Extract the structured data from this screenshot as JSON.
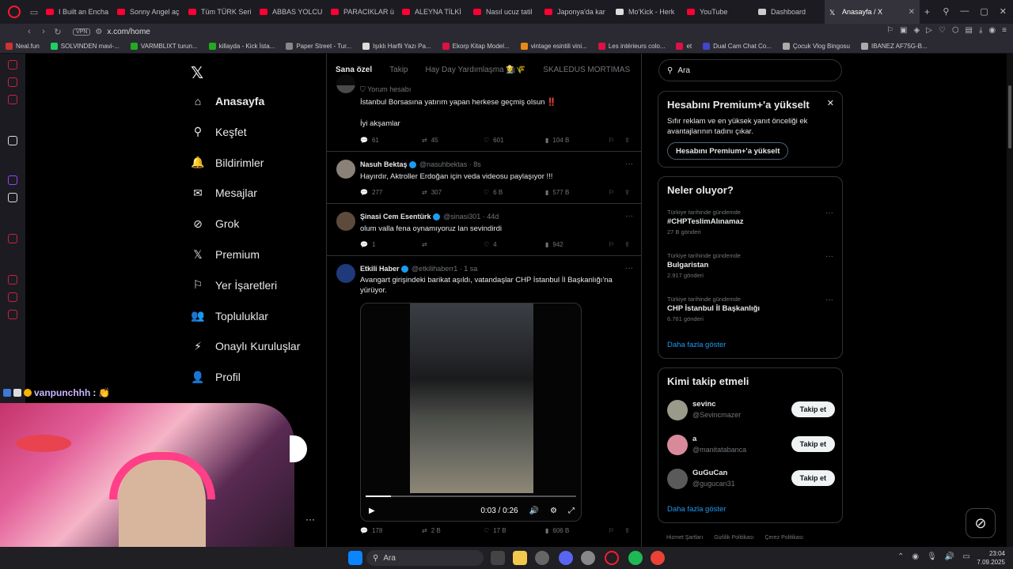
{
  "browser": {
    "tabs": [
      {
        "label": "I Built an Encha",
        "icon": "youtube-icon"
      },
      {
        "label": "Sonny Angel aç",
        "icon": "youtube-icon"
      },
      {
        "label": "Tüm TÜRK Seri",
        "icon": "youtube-icon"
      },
      {
        "label": "ABBAS YOLCU",
        "icon": "youtube-icon"
      },
      {
        "label": "PARACIKLAR ü",
        "icon": "youtube-icon"
      },
      {
        "label": "ALEYNA TİLKİ",
        "icon": "youtube-icon"
      },
      {
        "label": "Nasıl ucuz tatil",
        "icon": "youtube-icon"
      },
      {
        "label": "Japonya'da kar",
        "icon": "youtube-icon"
      },
      {
        "label": "Mo'Kick - Herk",
        "icon": "page-icon"
      },
      {
        "label": "YouTube",
        "icon": "youtube-icon"
      },
      {
        "label": "Dashboard",
        "icon": "dashboard-icon"
      },
      {
        "label": "Anasayfa / X",
        "icon": "x-icon",
        "active": true
      }
    ],
    "url": "x.com/home",
    "vpn_label": "VPN",
    "bookmarks": [
      "Neal.fun",
      "SOLVINDEN mavi-...",
      "VARMBLIXT turun...",
      "killayda - Kick İsta...",
      "Paper Street - Tur...",
      "Işıklı Harfli Yazı Pa...",
      "Ekorp Kitap Model...",
      "vintage esintili vini...",
      "Les intérieurs colo...",
      "et",
      "Dual Cam Chat Co...",
      "Çocuk Vlog Bingosu",
      "IBANEZ AF75G-B..."
    ]
  },
  "nav": {
    "logo": "𝕏",
    "items": [
      {
        "label": "Anasayfa",
        "icon": "home-icon",
        "glyph": "⌂",
        "active": true
      },
      {
        "label": "Keşfet",
        "icon": "search-icon",
        "glyph": "⚲"
      },
      {
        "label": "Bildirimler",
        "icon": "bell-icon",
        "glyph": "🔔"
      },
      {
        "label": "Mesajlar",
        "icon": "mail-icon",
        "glyph": "✉"
      },
      {
        "label": "Grok",
        "icon": "grok-icon",
        "glyph": "⊘"
      },
      {
        "label": "Premium",
        "icon": "x-icon",
        "glyph": "𝕏"
      },
      {
        "label": "Yer İşaretleri",
        "icon": "bookmark-icon",
        "glyph": "⚐"
      },
      {
        "label": "Topluluklar",
        "icon": "communities-icon",
        "glyph": "👥"
      },
      {
        "label": "Onaylı Kuruluşlar",
        "icon": "lightning-icon",
        "glyph": "⚡"
      },
      {
        "label": "Profil",
        "icon": "person-icon",
        "glyph": "👤"
      }
    ]
  },
  "feed": {
    "tabs": [
      "Sana özel",
      "Takip",
      "Hay Day Yardımlaşma 👩‍🌾🌾",
      "SKALEDUS MORTIMAS"
    ],
    "tweets": [
      {
        "context": "Yorum hesabı",
        "body": "İstanbul Borsasına yatırım yapan herkese geçmiş olsun ‼️",
        "body2": "İyi akşamlar",
        "replies": "61",
        "reposts": "45",
        "likes": "601",
        "views": "104 B"
      },
      {
        "name": "Nasuh Bektaş",
        "handle": "@nasuhbektas · 8s",
        "body": "Hayırdır,  Aktroller Erdoğan için veda videosu paylaşıyor !!!",
        "replies": "277",
        "reposts": "307",
        "likes": "6 B",
        "views": "577 B"
      },
      {
        "name": "Şinasi Cem Esentürk",
        "handle": "@sinasi301 · 44d",
        "body": "olum valla fena oynamıyoruz lan sevindirdi",
        "replies": "1",
        "reposts": "",
        "likes": "4",
        "views": "942"
      },
      {
        "name": "Etkili Haber",
        "handle": "@etkilihaberr1 · 1 sa",
        "body": "Avangart girişindeki barikat aşıldı, vatandaşlar CHP İstanbul İl Başkanlığı'na yürüyor.",
        "video_time": "0:03 / 0:26",
        "video_progress": 0.12,
        "replies": "178",
        "reposts": "2 B",
        "likes": "17 B",
        "views": "606 B"
      }
    ]
  },
  "right": {
    "search_placeholder": "Ara",
    "premium": {
      "title": "Hesabını Premium+'a yükselt",
      "body": "Sıfır reklam ve en yüksek yanıt önceliği ek avantajlarının tadını çıkar.",
      "button": "Hesabını Premium+'a yükselt"
    },
    "trends": {
      "title": "Neler oluyor?",
      "items": [
        {
          "context": "Türkiye tarihinde gündemde",
          "topic": "#CHPTeslimAlınamaz",
          "count": "27 B gönderi"
        },
        {
          "context": "Türkiye tarihinde gündemde",
          "topic": "Bulgaristan",
          "count": "2.917 gönderi"
        },
        {
          "context": "Türkiye tarihinde gündemde",
          "topic": "CHP İstanbul İl Başkanlığı",
          "count": "6.761 gönderi"
        }
      ],
      "more": "Daha fazla göster"
    },
    "who_to_follow": {
      "title": "Kimi takip etmeli",
      "users": [
        {
          "name": "sevinc",
          "handle": "@Sevincmazer",
          "button": "Takip et"
        },
        {
          "name": "a",
          "handle": "@manitatabanca",
          "button": "Takip et"
        },
        {
          "name": "GuGuCan",
          "handle": "@gugucan31",
          "button": "Takip et"
        }
      ],
      "more": "Daha fazla göster"
    },
    "footer": [
      "Hizmet Şartları",
      "Gizlilik Politikası",
      "Çerez Politikası"
    ]
  },
  "stream": {
    "chat_user": "vanpunchhh",
    "chat_text": ":",
    "chat_emoji": "👏"
  },
  "taskbar": {
    "search": "Ara",
    "time": "23:04",
    "date": "7.09.2025"
  },
  "colors": {
    "accent": "#1d9bf0",
    "background": "#000000",
    "border": "#2f3336",
    "muted": "#71767b",
    "browser_red": "#ff1b2d"
  }
}
